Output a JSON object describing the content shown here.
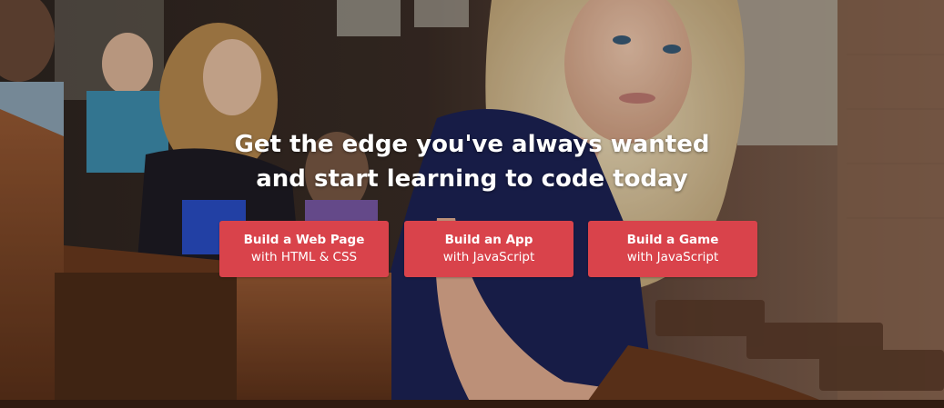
{
  "hero": {
    "headline_line1": "Get the edge you've always wanted",
    "headline_line2": "and start learning to code today"
  },
  "buttons": [
    {
      "title": "Build a Web Page",
      "subtitle": "with HTML & CSS"
    },
    {
      "title": "Build an App",
      "subtitle": "with JavaScript"
    },
    {
      "title": "Build a Game",
      "subtitle": "with JavaScript"
    }
  ],
  "colors": {
    "button_bg": "#d9434b",
    "text": "#ffffff"
  }
}
